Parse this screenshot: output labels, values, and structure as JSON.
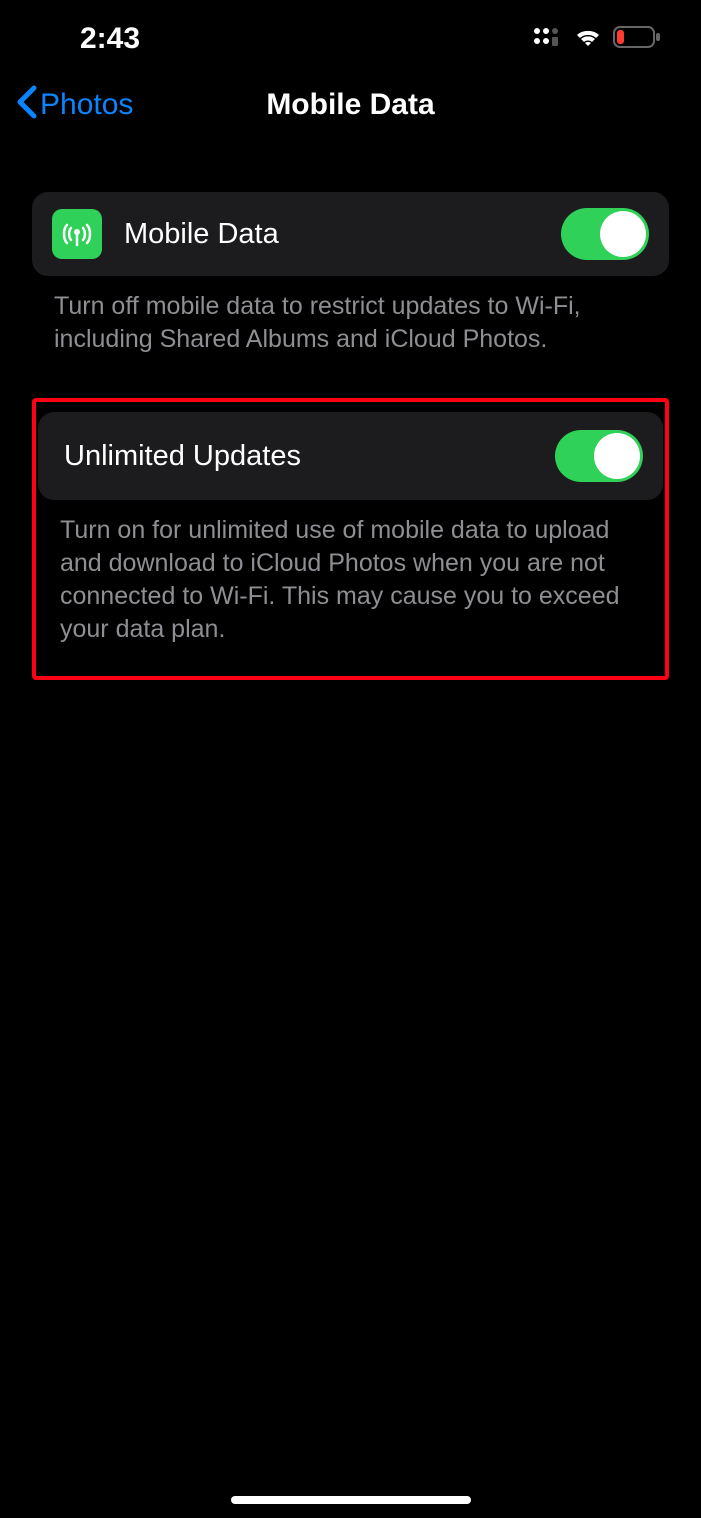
{
  "status_bar": {
    "time": "2:43"
  },
  "nav": {
    "back_label": "Photos",
    "title": "Mobile Data"
  },
  "settings": {
    "mobile_data": {
      "label": "Mobile Data",
      "on": true,
      "description": "Turn off mobile data to restrict updates to Wi-Fi, including Shared Albums and iCloud Photos."
    },
    "unlimited_updates": {
      "label": "Unlimited Updates",
      "on": true,
      "description": "Turn on for unlimited use of mobile data to upload and download to iCloud Photos when you are not connected to Wi-Fi. This may cause you to exceed your data plan."
    }
  }
}
